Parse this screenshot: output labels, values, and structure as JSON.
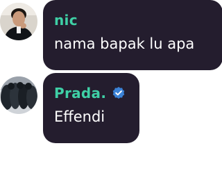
{
  "messages": [
    {
      "sender": "nic",
      "sender_color": "#3fd0a6",
      "text": "nama bapak lu apa",
      "verified": false,
      "avatar_icon": "user-photo-avatar-icon"
    },
    {
      "sender": "Prada.",
      "sender_color": "#3fd0a6",
      "text": "Effendi",
      "verified": true,
      "verified_icon": "verified-badge-icon",
      "avatar_icon": "group-photo-avatar-icon"
    }
  ],
  "colors": {
    "bubble": "#241d2e",
    "text": "#ffffff",
    "verified_badge": "#3b82d6"
  }
}
